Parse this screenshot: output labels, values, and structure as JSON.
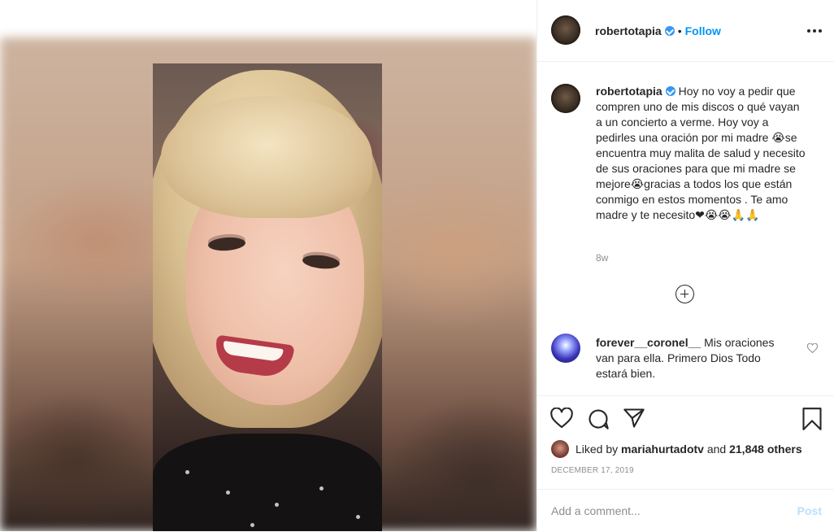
{
  "post": {
    "username": "robertotapia",
    "follow_label": "Follow",
    "separator": "•",
    "caption_text": "Hoy no voy a pedir que compren uno de mis discos o qué vayan a un concierto a verme. Hoy voy a pedirles una oración por mi madre 😭se encuentra muy malita de salud y necesito de sus oraciones para que mi madre se mejore😭gracias a todos los que están conmigo en estos momentos . Te amo madre y te necesito❤😭😭🙏🙏",
    "age": "8w",
    "date": "DECEMBER 17, 2019"
  },
  "comments": [
    {
      "username": "forever__coronel__",
      "text": "Mis oraciones van para ella. Primero Dios Todo estará bien."
    }
  ],
  "likes": {
    "prefix": "Liked by",
    "user": "mariahurtadotv",
    "and": "and",
    "others": "21,848 others"
  },
  "composer": {
    "placeholder": "Add a comment...",
    "post_label": "Post"
  },
  "icons": {
    "more": "more-options-icon",
    "like": "heart-icon",
    "comment": "comment-icon",
    "share": "share-icon",
    "save": "bookmark-icon",
    "load_more": "plus-circle-icon",
    "verified": "verified-badge-icon"
  },
  "colors": {
    "accent": "#0095f6",
    "verified": "#3897f0",
    "muted": "#8e8e8e",
    "post_disabled": "#b9dffc"
  }
}
